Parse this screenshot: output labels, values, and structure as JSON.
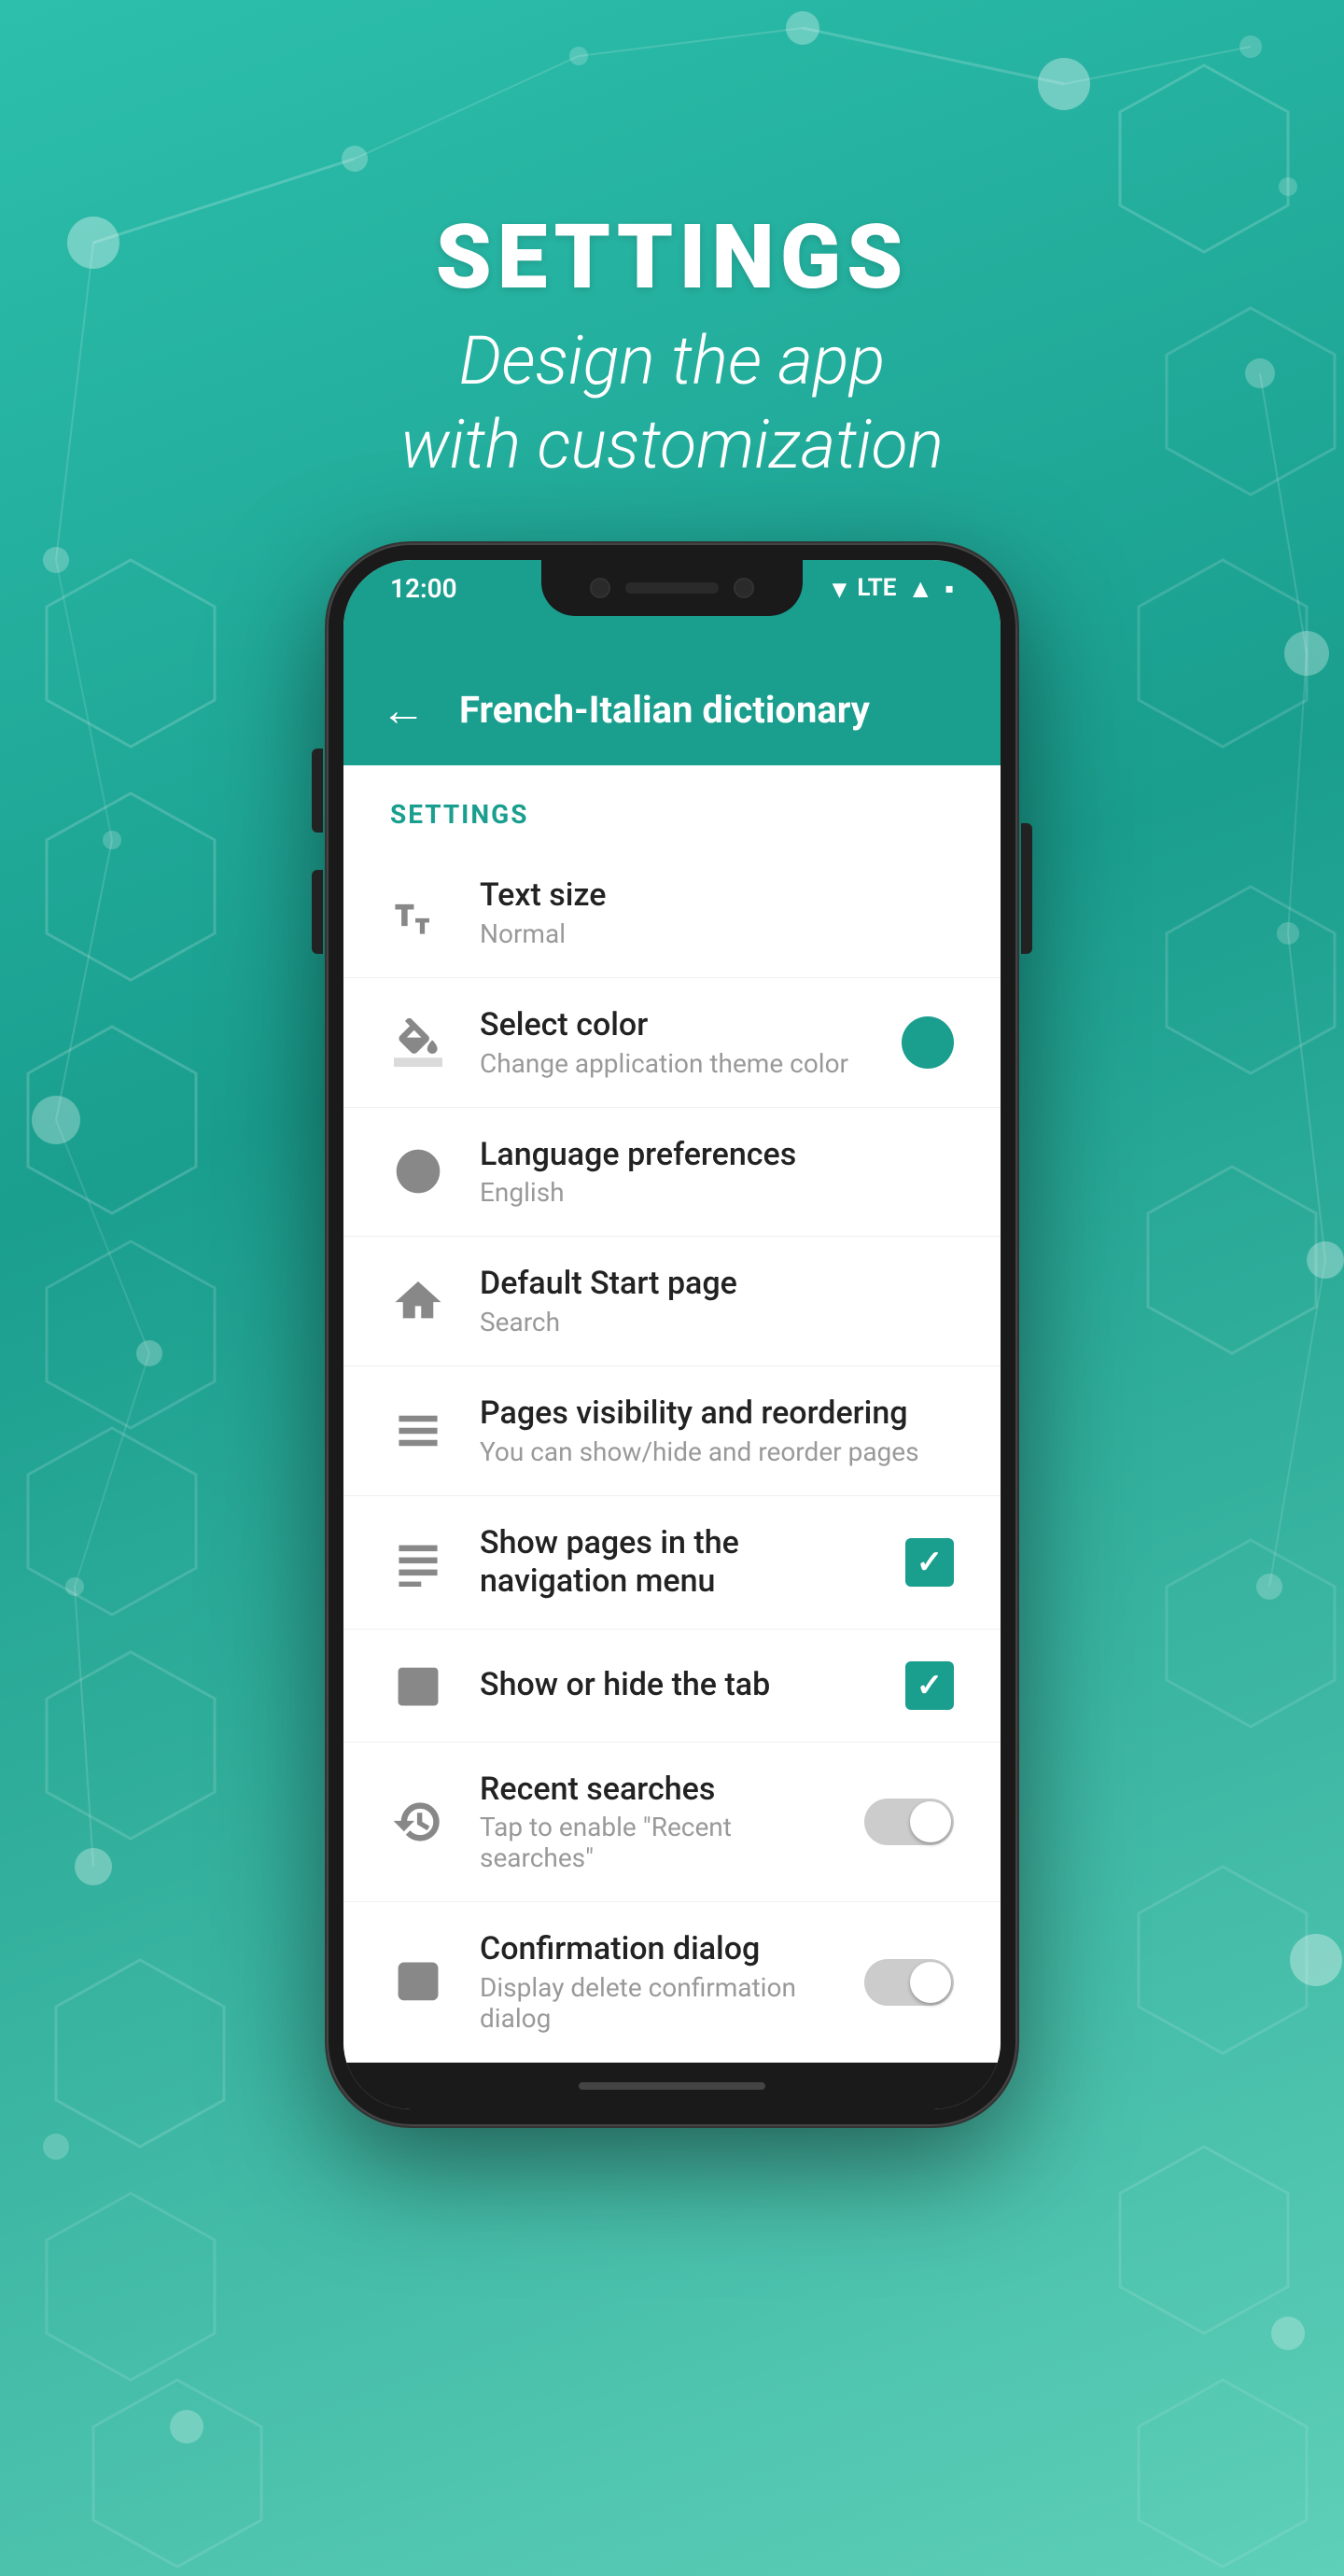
{
  "background": {
    "color_start": "#2dbfac",
    "color_end": "#5ecfb8"
  },
  "hero": {
    "title": "SETTINGS",
    "subtitle_line1": "Design the app",
    "subtitle_line2": "with customization"
  },
  "status_bar": {
    "time": "12:00",
    "wifi": "▾",
    "lte": "LTE",
    "signal": "▲",
    "battery": "▪"
  },
  "app_bar": {
    "back_label": "←",
    "title": "French-Italian dictionary"
  },
  "settings": {
    "section_label": "SETTINGS",
    "items": [
      {
        "id": "text-size",
        "title": "Text size",
        "subtitle": "Normal",
        "icon": "text-size",
        "control": "none"
      },
      {
        "id": "select-color",
        "title": "Select color",
        "subtitle": "Change application theme color",
        "icon": "paint-bucket",
        "control": "color-dot",
        "control_value": "#1a9e8e"
      },
      {
        "id": "language-preferences",
        "title": "Language preferences",
        "subtitle": "English",
        "icon": "globe",
        "control": "none"
      },
      {
        "id": "default-start-page",
        "title": "Default Start page",
        "subtitle": "Search",
        "icon": "home",
        "control": "none"
      },
      {
        "id": "pages-visibility",
        "title": "Pages visibility and reordering",
        "subtitle": "You can show/hide and reorder pages",
        "icon": "menu",
        "control": "none"
      },
      {
        "id": "show-pages-nav",
        "title": "Show pages in the navigation menu",
        "subtitle": "",
        "icon": "menu-lines",
        "control": "checkbox",
        "control_value": true
      },
      {
        "id": "show-hide-tab",
        "title": "Show or hide the tab",
        "subtitle": "",
        "icon": "tab",
        "control": "checkbox",
        "control_value": true
      },
      {
        "id": "recent-searches",
        "title": "Recent searches",
        "subtitle": "Tap to enable \"Recent searches\"",
        "icon": "history",
        "control": "toggle",
        "control_value": false
      },
      {
        "id": "confirmation-dialog",
        "title": "Confirmation dialog",
        "subtitle": "Display delete confirmation dialog",
        "icon": "dialog",
        "control": "toggle",
        "control_value": false
      }
    ]
  }
}
